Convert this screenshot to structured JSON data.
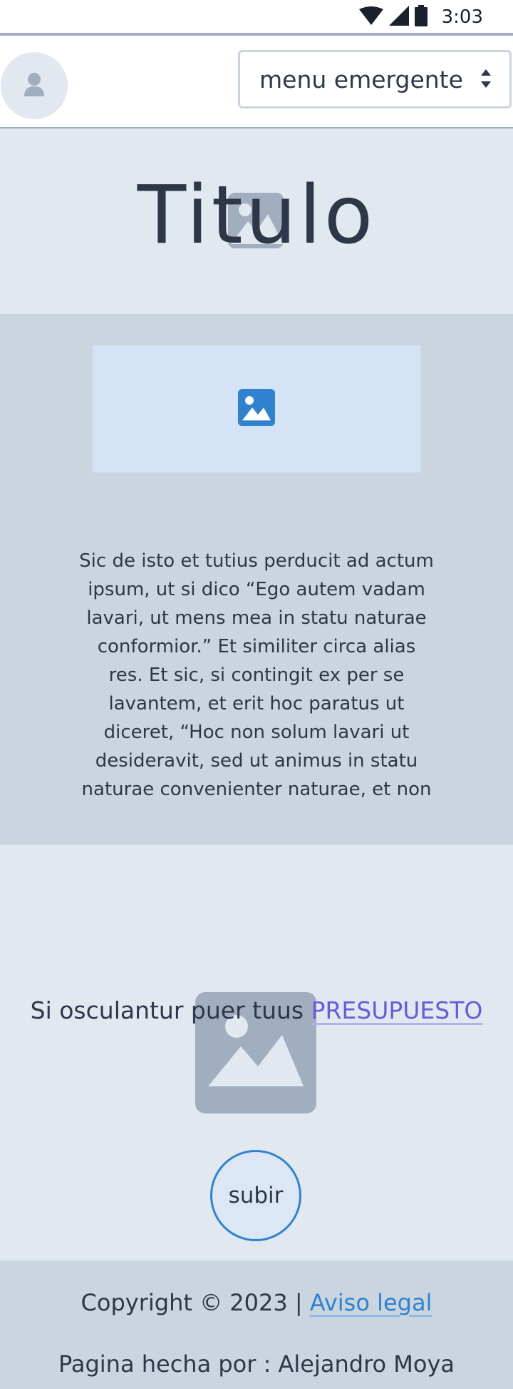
{
  "status_bar": {
    "time": "3:03",
    "icons": [
      "wifi-icon",
      "signal-icon",
      "battery-icon"
    ]
  },
  "header": {
    "avatar_icon": "user-icon",
    "menu": {
      "selected": "menu emergente",
      "arrow_icon": "updown-arrows-icon"
    }
  },
  "hero": {
    "title": "Titulo",
    "image_icon": "image-placeholder-icon"
  },
  "content": {
    "image_icon": "image-icon",
    "paragraph": "Sic de isto et tutius perducit ad actum ipsum, ut si dico “Ego autem vadam lavari, ut mens mea in statu naturae conformior.” Et similiter circa alias res. Et sic, si contingit ex per se lavantem, et erit hoc paratus ut diceret, “Hoc non solum lavari ut desideravit, sed ut animus in statu naturae convenienter naturae, et non"
  },
  "cta": {
    "text": "Si osculantur puer tuus ",
    "link": "PRESUPUESTO",
    "image_icon": "image-placeholder-icon",
    "button": "subir"
  },
  "footer": {
    "copyright": "Copyright © 2023  |  ",
    "legal_link": " Aviso legal",
    "credit": "Pagina hecha por : Alejandro Moya"
  },
  "colors": {
    "page_bg": "#e2e8f0",
    "section_bg": "#cbd5e0",
    "text": "#2d3748",
    "accent_blue": "#3182ce",
    "link_purple": "#6b5bd8",
    "placeholder_gray": "#a0aec0"
  }
}
